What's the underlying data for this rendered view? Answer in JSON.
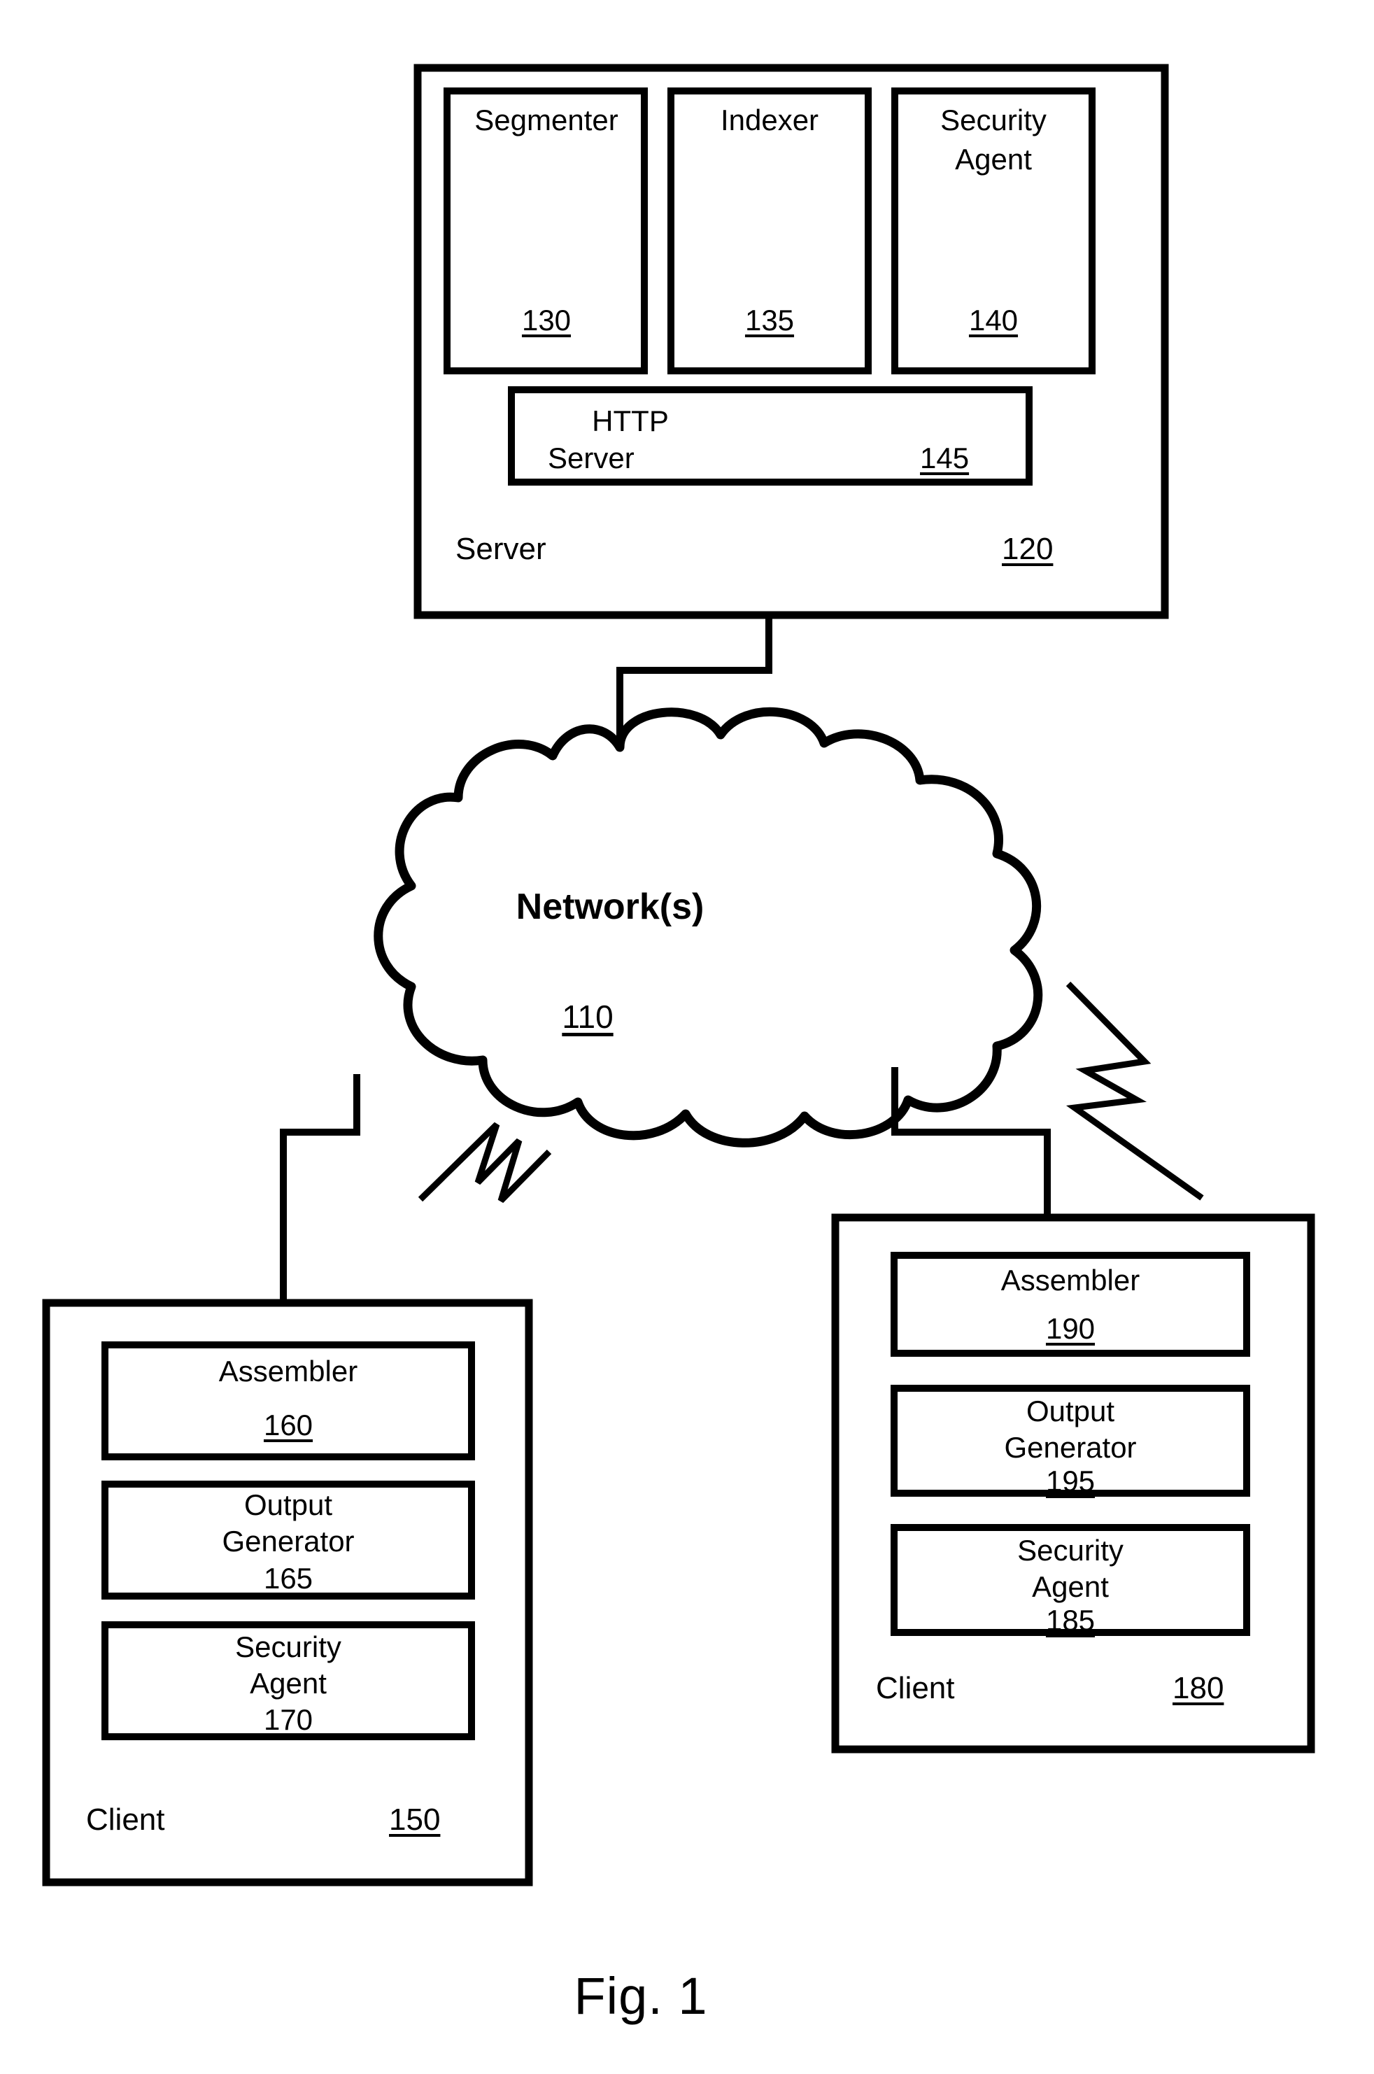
{
  "figure": {
    "caption": "Fig. 1",
    "title": "Fig. 1"
  },
  "server": {
    "container_label": "Server",
    "container_ref": "120",
    "components": [
      {
        "name": "segmenter",
        "label": "Segmenter",
        "ref": "130"
      },
      {
        "name": "indexer",
        "label": "Indexer",
        "ref": "135"
      },
      {
        "name": "security-agent",
        "label_line1": "Security",
        "label_line2": "Agent",
        "ref": "140"
      }
    ],
    "http_server": {
      "label_line1": "HTTP",
      "label_line2": "Server",
      "ref": "145"
    }
  },
  "network": {
    "label": "Network(s)",
    "ref": "110"
  },
  "client_left": {
    "container_label": "Client",
    "container_ref": "150",
    "components": [
      {
        "name": "assembler",
        "label": "Assembler",
        "ref": "160"
      },
      {
        "name": "output-generator",
        "label_line1": "Output",
        "label_line2": "Generator",
        "ref": "165"
      },
      {
        "name": "security-agent",
        "label_line1": "Security",
        "label_line2": "Agent",
        "ref": "170"
      }
    ]
  },
  "client_right": {
    "container_label": "Client",
    "container_ref": "180",
    "components": [
      {
        "name": "assembler",
        "label": "Assembler",
        "ref": "190"
      },
      {
        "name": "output-generator",
        "label_line1": "Output",
        "label_line2": "Generator",
        "ref": "195"
      },
      {
        "name": "security-agent",
        "label_line1": "Security",
        "label_line2": "Agent",
        "ref": "185"
      }
    ]
  },
  "connectors": {
    "server_to_network": "wired-link",
    "network_to_client_left": "wired-link",
    "network_to_client_right": "wired-link"
  },
  "wireless_icons": [
    {
      "name": "lightning-bolt-left",
      "meaning": "wireless-link"
    },
    {
      "name": "lightning-bolt-right",
      "meaning": "wireless-link"
    }
  ],
  "colors": {
    "ink": "#000000",
    "paper": "#ffffff"
  }
}
